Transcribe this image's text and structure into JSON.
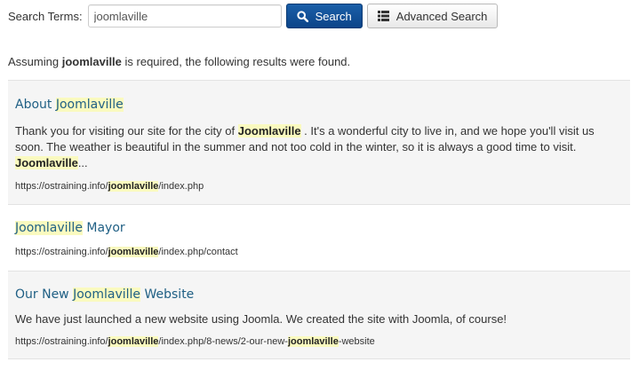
{
  "search": {
    "label": "Search Terms:",
    "value": "joomlaville",
    "search_button": "Search",
    "advanced_button": "Advanced Search"
  },
  "summary": {
    "prefix": "Assuming ",
    "term": "joomlaville",
    "suffix": " is required, the following results were found."
  },
  "results": [
    {
      "title_pre": "About ",
      "title_hl": "Joomlaville",
      "title_post": "",
      "text_1": "Thank you for visiting our site for the city of ",
      "text_hl_1": "Joomlaville",
      "text_2": " . It's a wonderful city to live in, and we hope you'll visit us soon. The weather is beautiful in the summer and not too cold in the winter, so it is always a good time to visit. ",
      "text_hl_2": "Joomlaville",
      "text_3": "...",
      "url_pre": "https://ostraining.info/",
      "url_hl": "joomlaville",
      "url_post": "/index.php"
    },
    {
      "title_pre": "",
      "title_hl": "Joomlaville",
      "title_post": " Mayor",
      "url_pre": "https://ostraining.info/",
      "url_hl": "joomlaville",
      "url_post": "/index.php/contact"
    },
    {
      "title_pre": "Our New ",
      "title_hl": "Joomlaville",
      "title_post": " Website",
      "text": "We have just launched a new website using Joomla. We created the site with Joomla, of course!",
      "url_pre": "https://ostraining.info/",
      "url_hl": "joomlaville",
      "url_mid": "/index.php/8-news/2-our-new-",
      "url_hl_2": "joomlaville",
      "url_post": "-website"
    }
  ],
  "colors": {
    "primary_button": "#0c4589",
    "highlight": "#fafabf",
    "title_link": "#1f5f84"
  }
}
